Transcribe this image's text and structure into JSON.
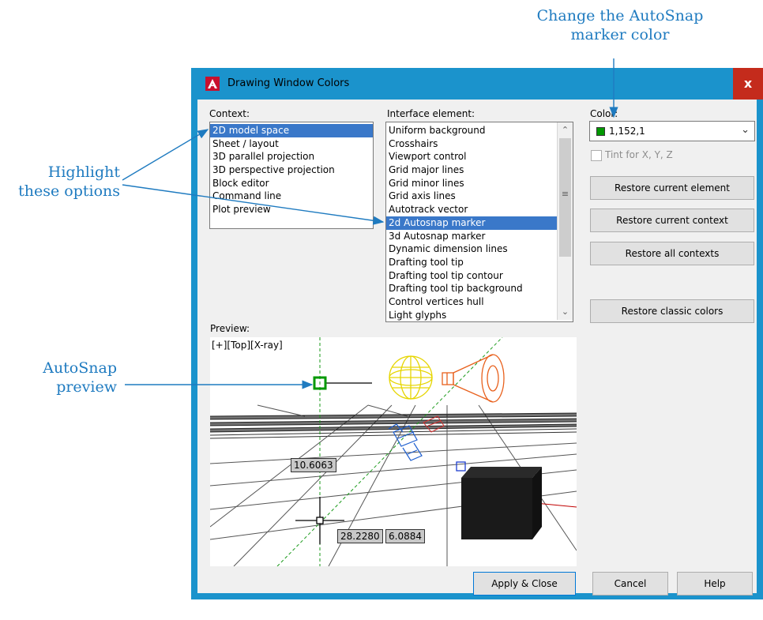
{
  "callouts": {
    "color_line1": "Change the AutoSnap",
    "color_line2": "marker color",
    "highlight_line1": "Highlight",
    "highlight_line2": "these options",
    "autosnap_line1": "AutoSnap",
    "autosnap_line2": "preview"
  },
  "dialog": {
    "title": "Drawing Window Colors",
    "close_glyph": "x",
    "accent_color": "#1b93cc"
  },
  "context": {
    "label": "Context:",
    "items": [
      "2D model space",
      "Sheet / layout",
      "3D parallel projection",
      "3D perspective projection",
      "Block editor",
      "Command line",
      "Plot preview"
    ],
    "selected_index": 0
  },
  "interface_element": {
    "label": "Interface element:",
    "items": [
      "Uniform background",
      "Crosshairs",
      "Viewport control",
      "Grid major lines",
      "Grid minor lines",
      "Grid axis lines",
      "Autotrack vector",
      "2d Autosnap marker",
      "3d Autosnap marker",
      "Dynamic dimension lines",
      "Drafting tool tip",
      "Drafting tool tip contour",
      "Drafting tool tip background",
      "Control vertices hull",
      "Light glyphs"
    ],
    "selected_index": 7
  },
  "color": {
    "label": "Color:",
    "value": "1,152,1",
    "swatch": "#019801",
    "tint_label": "Tint for X, Y, Z",
    "tint_checked": false
  },
  "buttons": {
    "restore_element": "Restore current element",
    "restore_context": "Restore current context",
    "restore_all": "Restore all contexts",
    "restore_classic": "Restore classic colors",
    "apply_close": "Apply & Close",
    "cancel": "Cancel",
    "help": "Help"
  },
  "preview": {
    "label": "Preview:",
    "viewport_label": "[+][Top][X-ray]",
    "dim_1": "10.6063",
    "dim_2": "28.2280",
    "dim_3": "6.0884"
  }
}
